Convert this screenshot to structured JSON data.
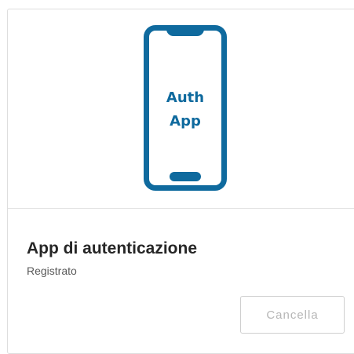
{
  "illustration": {
    "icon": "auth-app-phone-icon",
    "line1": "Auth",
    "line2": "App",
    "color": "#0f6a9e"
  },
  "card": {
    "title": "App di autenticazione",
    "status": "Registrato",
    "cancel_label": "Cancella"
  }
}
